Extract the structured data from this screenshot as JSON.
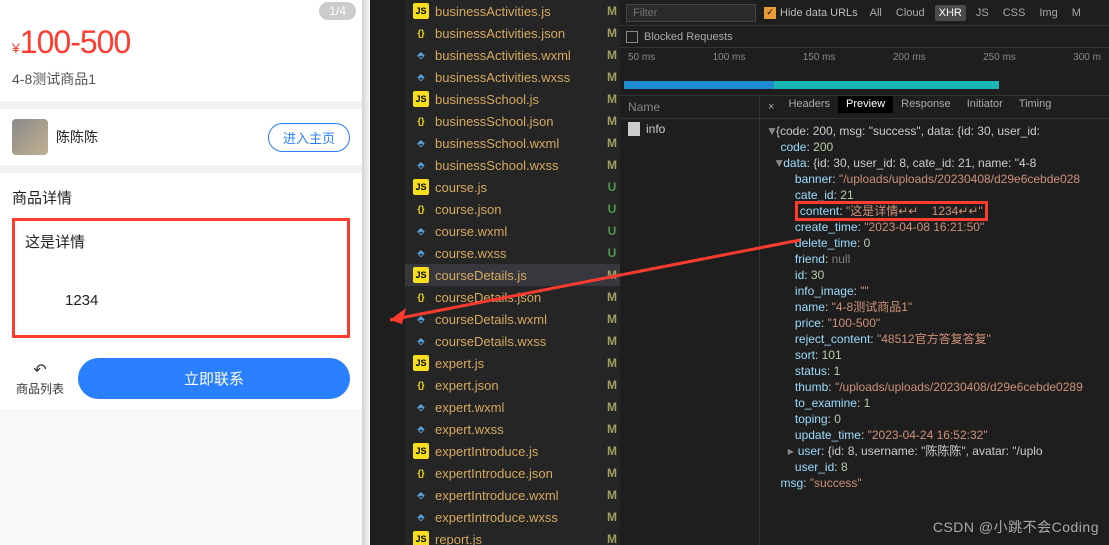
{
  "mobile": {
    "pager": "1/4",
    "currency": "¥",
    "price": "100-500",
    "productName": "4-8测试商品1",
    "username": "陈陈陈",
    "enterBtn": "进入主页",
    "detailTitle": "商品详情",
    "detailLine1": "这是详情",
    "detailLine2": "1234",
    "backLabel": "商品列表",
    "contactBtn": "立即联系"
  },
  "files": [
    {
      "name": "businessActivities.js",
      "icon": "js",
      "status": "M"
    },
    {
      "name": "businessActivities.json",
      "icon": "json",
      "status": "M"
    },
    {
      "name": "businessActivities.wxml",
      "icon": "wxml",
      "status": "M"
    },
    {
      "name": "businessActivities.wxss",
      "icon": "wxss",
      "status": "M"
    },
    {
      "name": "businessSchool.js",
      "icon": "js",
      "status": "M"
    },
    {
      "name": "businessSchool.json",
      "icon": "json",
      "status": "M"
    },
    {
      "name": "businessSchool.wxml",
      "icon": "wxml",
      "status": "M"
    },
    {
      "name": "businessSchool.wxss",
      "icon": "wxss",
      "status": "M"
    },
    {
      "name": "course.js",
      "icon": "js",
      "status": "U"
    },
    {
      "name": "course.json",
      "icon": "json",
      "status": "U"
    },
    {
      "name": "course.wxml",
      "icon": "wxml",
      "status": "U"
    },
    {
      "name": "course.wxss",
      "icon": "wxss",
      "status": "U"
    },
    {
      "name": "courseDetails.js",
      "icon": "js",
      "status": "M",
      "selected": true
    },
    {
      "name": "courseDetails.json",
      "icon": "json",
      "status": "M"
    },
    {
      "name": "courseDetails.wxml",
      "icon": "wxml",
      "status": "M"
    },
    {
      "name": "courseDetails.wxss",
      "icon": "wxss",
      "status": "M"
    },
    {
      "name": "expert.js",
      "icon": "js",
      "status": "M"
    },
    {
      "name": "expert.json",
      "icon": "json",
      "status": "M"
    },
    {
      "name": "expert.wxml",
      "icon": "wxml",
      "status": "M"
    },
    {
      "name": "expert.wxss",
      "icon": "wxss",
      "status": "M"
    },
    {
      "name": "expertIntroduce.js",
      "icon": "js",
      "status": "M"
    },
    {
      "name": "expertIntroduce.json",
      "icon": "json",
      "status": "M"
    },
    {
      "name": "expertIntroduce.wxml",
      "icon": "wxml",
      "status": "M"
    },
    {
      "name": "expertIntroduce.wxss",
      "icon": "wxss",
      "status": "M"
    },
    {
      "name": "report.js",
      "icon": "js",
      "status": "M"
    }
  ],
  "dev": {
    "filterPlaceholder": "Filter",
    "hideDataUrls": "Hide data URLs",
    "filterTabs": [
      "All",
      "Cloud",
      "XHR",
      "JS",
      "CSS",
      "Img",
      "M"
    ],
    "activeFilter": "XHR",
    "blockedRequests": "Blocked Requests",
    "timelineMarks": [
      "50 ms",
      "100 ms",
      "150 ms",
      "200 ms",
      "250 ms",
      "300 m"
    ],
    "nameHeader": "Name",
    "requests": [
      "info"
    ],
    "detailTabs": [
      "Headers",
      "Preview",
      "Response",
      "Initiator",
      "Timing"
    ],
    "activeDetailTab": "Preview",
    "json": {
      "topline": "{code: 200, msg: \"success\", data: {id: 30, user_id:",
      "code": "200",
      "dataLine": "{id: 30, user_id: 8, cate_id: 21, name: \"4-8",
      "banner": "\"/uploads/uploads/20230408/d29e6cebde028",
      "cate_id": "21",
      "content": "\"这是详情↵↵    1234↵↵\"",
      "create_time": "\"2023-04-08 16:21:50\"",
      "delete_time": "0",
      "friend": "null",
      "id": "30",
      "info_image": "\"\"",
      "name": "\"4-8测试商品1\"",
      "price": "\"100-500\"",
      "reject_content": "\"48512官方答复答复\"",
      "sort": "101",
      "status": "1",
      "thumb": "\"/uploads/uploads/20230408/d29e6cebde0289",
      "to_examine": "1",
      "toping": "0",
      "update_time": "\"2023-04-24 16:52:32\"",
      "user": "{id: 8, username: \"陈陈陈\", avatar: \"/uplo",
      "user_id": "8",
      "msg": "\"success\""
    }
  },
  "watermark": "CSDN @小跳不会Coding"
}
